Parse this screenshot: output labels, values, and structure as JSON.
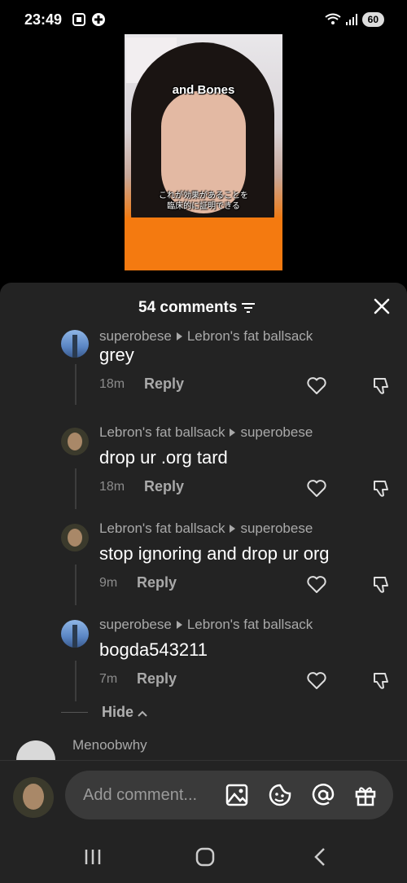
{
  "status_bar": {
    "time": "23:49",
    "battery": "60"
  },
  "video": {
    "caption_top": "and Bones",
    "caption_bottom": "これが効果があることを臨床的に証明できる"
  },
  "comments_panel": {
    "title": "54 comments",
    "replies": [
      {
        "author": "superobese",
        "reply_to": "Lebron's fat ballsack",
        "text": "grey",
        "time": "18m",
        "reply_label": "Reply",
        "avatar": "tower-avatar"
      },
      {
        "author": "Lebron's fat ballsack",
        "reply_to": "superobese",
        "text": "drop ur .org tard",
        "time": "18m",
        "reply_label": "Reply",
        "avatar": "face-avatar"
      },
      {
        "author": "Lebron's fat ballsack",
        "reply_to": "superobese",
        "text": "stop ignoring and drop ur org",
        "time": "9m",
        "reply_label": "Reply",
        "avatar": "face-avatar"
      },
      {
        "author": "superobese",
        "reply_to": "Lebron's fat ballsack",
        "text": "bogda543211",
        "time": "7m",
        "reply_label": "Reply",
        "avatar": "tower-avatar"
      }
    ],
    "hide_label": "Hide",
    "next_comment_author": "Menoobwhy"
  },
  "composer": {
    "placeholder": "Add comment..."
  },
  "colors": {
    "sheet_bg": "#232323",
    "accent_text": "#ffffff",
    "muted_text": "#a9a9a9"
  }
}
